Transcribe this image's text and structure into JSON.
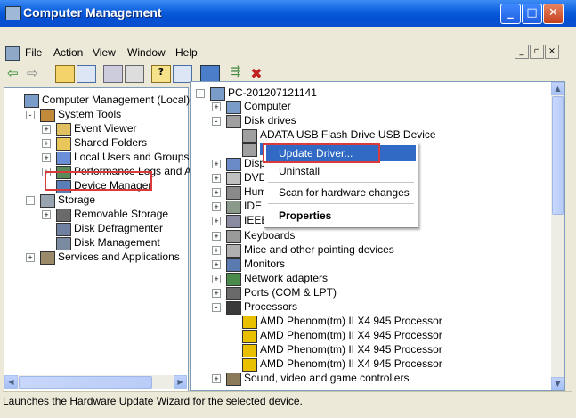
{
  "window": {
    "title": "Computer Management"
  },
  "menu": [
    "File",
    "Action",
    "View",
    "Window",
    "Help"
  ],
  "left_tree": [
    {
      "label": "Computer Management (Local)",
      "icon": "computer-management-icon",
      "expander": ""
    },
    {
      "label": "System Tools",
      "icon": "system-tools-icon",
      "expander": "-"
    },
    {
      "label": "Event Viewer",
      "icon": "event-viewer-icon",
      "expander": "+"
    },
    {
      "label": "Shared Folders",
      "icon": "shared-folders-icon",
      "expander": "+"
    },
    {
      "label": "Local Users and Groups",
      "icon": "users-icon",
      "expander": "+"
    },
    {
      "label": "Performance Logs and Alerts",
      "icon": "performance-icon",
      "expander": "+"
    },
    {
      "label": "Device Manager",
      "icon": "device-manager-icon",
      "expander": "",
      "highlighted": true
    },
    {
      "label": "Storage",
      "icon": "storage-icon",
      "expander": "-"
    },
    {
      "label": "Removable Storage",
      "icon": "removable-storage-icon",
      "expander": "+"
    },
    {
      "label": "Disk Defragmenter",
      "icon": "defrag-icon",
      "expander": ""
    },
    {
      "label": "Disk Management",
      "icon": "disk-management-icon",
      "expander": ""
    },
    {
      "label": "Services and Applications",
      "icon": "services-icon",
      "expander": "+"
    }
  ],
  "right_tree": [
    {
      "label": "PC-201207121141",
      "icon": "computer-icon",
      "expander": "-"
    },
    {
      "label": "Computer",
      "icon": "computer-icon",
      "expander": "+"
    },
    {
      "label": "Disk drives",
      "icon": "disk-icon",
      "expander": "-"
    },
    {
      "label": "ADATA USB Flash Drive USB Device",
      "icon": "disk-icon",
      "expander": ""
    },
    {
      "label": "",
      "icon": "disk-icon",
      "expander": "",
      "selected": true
    },
    {
      "label": "Displ",
      "icon": "display-icon",
      "expander": "+"
    },
    {
      "label": "DVD/",
      "icon": "dvd-icon",
      "expander": "+"
    },
    {
      "label": "Hum",
      "icon": "hid-icon",
      "expander": "+"
    },
    {
      "label": "IDE A",
      "icon": "ide-icon",
      "expander": "+"
    },
    {
      "label": "IEEE",
      "icon": "ieee-icon",
      "expander": "+"
    },
    {
      "label": "Keyboards",
      "icon": "keyboard-icon",
      "expander": "+"
    },
    {
      "label": "Mice and other pointing devices",
      "icon": "mouse-icon",
      "expander": "+"
    },
    {
      "label": "Monitors",
      "icon": "monitor-icon",
      "expander": "+"
    },
    {
      "label": "Network adapters",
      "icon": "network-icon",
      "expander": "+"
    },
    {
      "label": "Ports (COM & LPT)",
      "icon": "port-icon",
      "expander": "+"
    },
    {
      "label": "Processors",
      "icon": "processor-icon",
      "expander": "-"
    },
    {
      "label": "AMD Phenom(tm) II X4 945 Processor",
      "icon": "processor-warning-icon",
      "expander": ""
    },
    {
      "label": "AMD Phenom(tm) II X4 945 Processor",
      "icon": "processor-warning-icon",
      "expander": ""
    },
    {
      "label": "AMD Phenom(tm) II X4 945 Processor",
      "icon": "processor-warning-icon",
      "expander": ""
    },
    {
      "label": "AMD Phenom(tm) II X4 945 Processor",
      "icon": "processor-warning-icon",
      "expander": ""
    },
    {
      "label": "Sound, video and game controllers",
      "icon": "sound-icon",
      "expander": "+"
    }
  ],
  "context_menu": {
    "update_driver": "Update Driver...",
    "uninstall": "Uninstall",
    "scan": "Scan for hardware changes",
    "properties": "Properties"
  },
  "status": "Launches the Hardware Update Wizard for the selected device.",
  "colors": {
    "title_bar": "#0a5ddd",
    "highlight": "#316ac5",
    "callout": "#d93b3b"
  }
}
